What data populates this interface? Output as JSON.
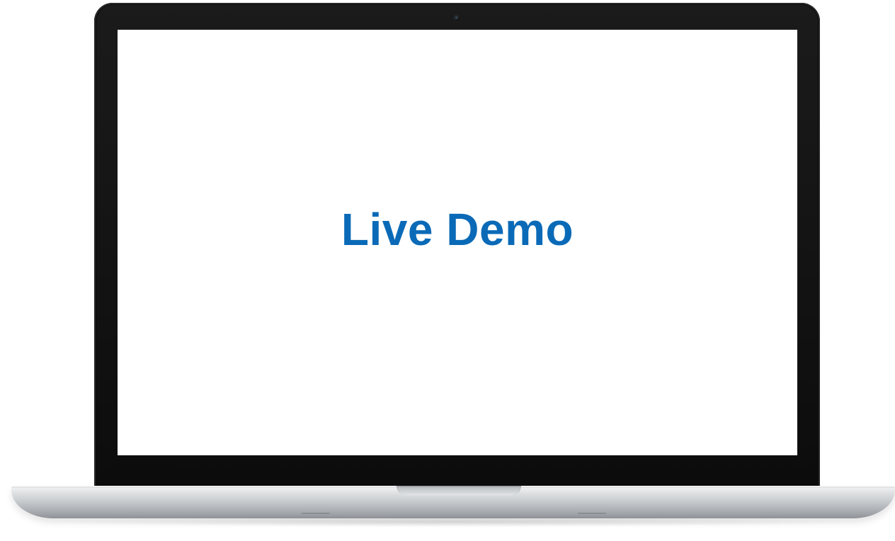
{
  "screen": {
    "title": "Live Demo"
  },
  "device": {
    "type": "laptop",
    "screen_text_color": "#0a6ab7",
    "bezel_color": "#111111",
    "body_color": "#c5c8cb"
  }
}
